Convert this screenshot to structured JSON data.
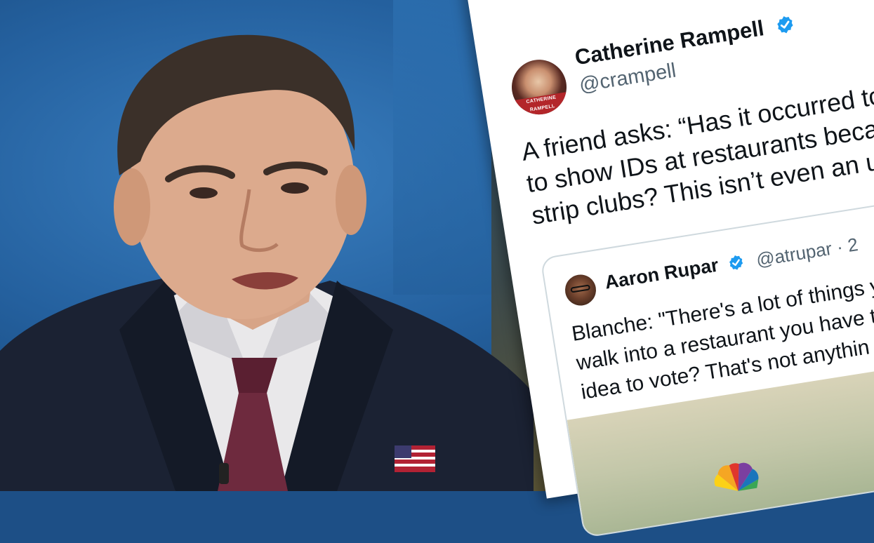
{
  "tweet": {
    "author_name": "Catherine Rampell",
    "author_handle": "@crampell",
    "avatar_caption": "CATHERINE RAMPELL",
    "text_lines": [
      "A friend asks: “Has it occurred to a",
      "to show IDs at restaurants becaus",
      "strip clubs? This isn’t even an unr"
    ],
    "quoted": {
      "author_name": "Aaron Rupar",
      "author_handle": "@atrupar · 2",
      "text_lines": [
        "Blanche: \"There's a lot of things y",
        "walk into a restaurant you have t",
        "idea to vote? That's not anythin"
      ]
    }
  },
  "icons": {
    "verified": "verified-badge-icon",
    "flag_pin": "american-flag-pin-icon",
    "network_logo": "peacock-logo-icon"
  },
  "colors": {
    "verified_blue": "#1d9bf0",
    "text_primary": "#0f1419",
    "text_secondary": "#536471",
    "studio_blue": "#24609e"
  }
}
